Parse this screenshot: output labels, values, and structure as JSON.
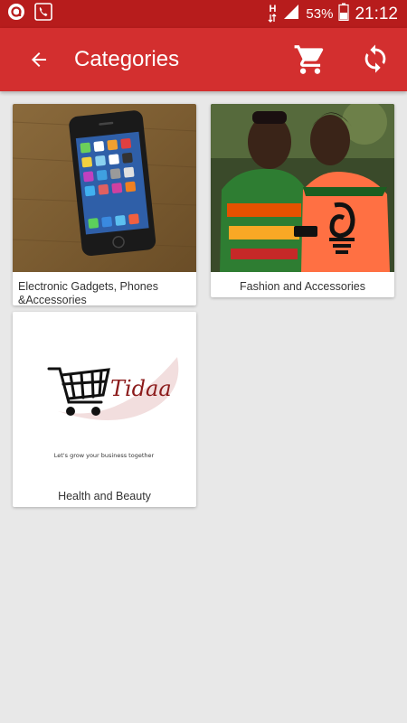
{
  "status_bar": {
    "network_label": "H",
    "battery_percent": "53%",
    "time": "21:12"
  },
  "app_bar": {
    "title": "Categories",
    "icons": [
      "arrow-back-icon",
      "shopping-cart-icon",
      "refresh-icon"
    ]
  },
  "categories": [
    {
      "label": "Electronic Gadgets, Phones &Accessories",
      "image": "smartphone-photo"
    },
    {
      "label": "Fashion and Accessories",
      "image": "couple-in-african-print-photo"
    },
    {
      "label": "Health and Beauty",
      "image": "tidaa-logo"
    }
  ],
  "logo": {
    "brand": "Tidaa",
    "tagline": "Let's grow your business together"
  },
  "colors": {
    "status_bar": "#b71c1c",
    "app_bar": "#d32f2f",
    "background": "#e8e8e8",
    "card": "#ffffff",
    "brand_red": "#8b1a1a"
  }
}
